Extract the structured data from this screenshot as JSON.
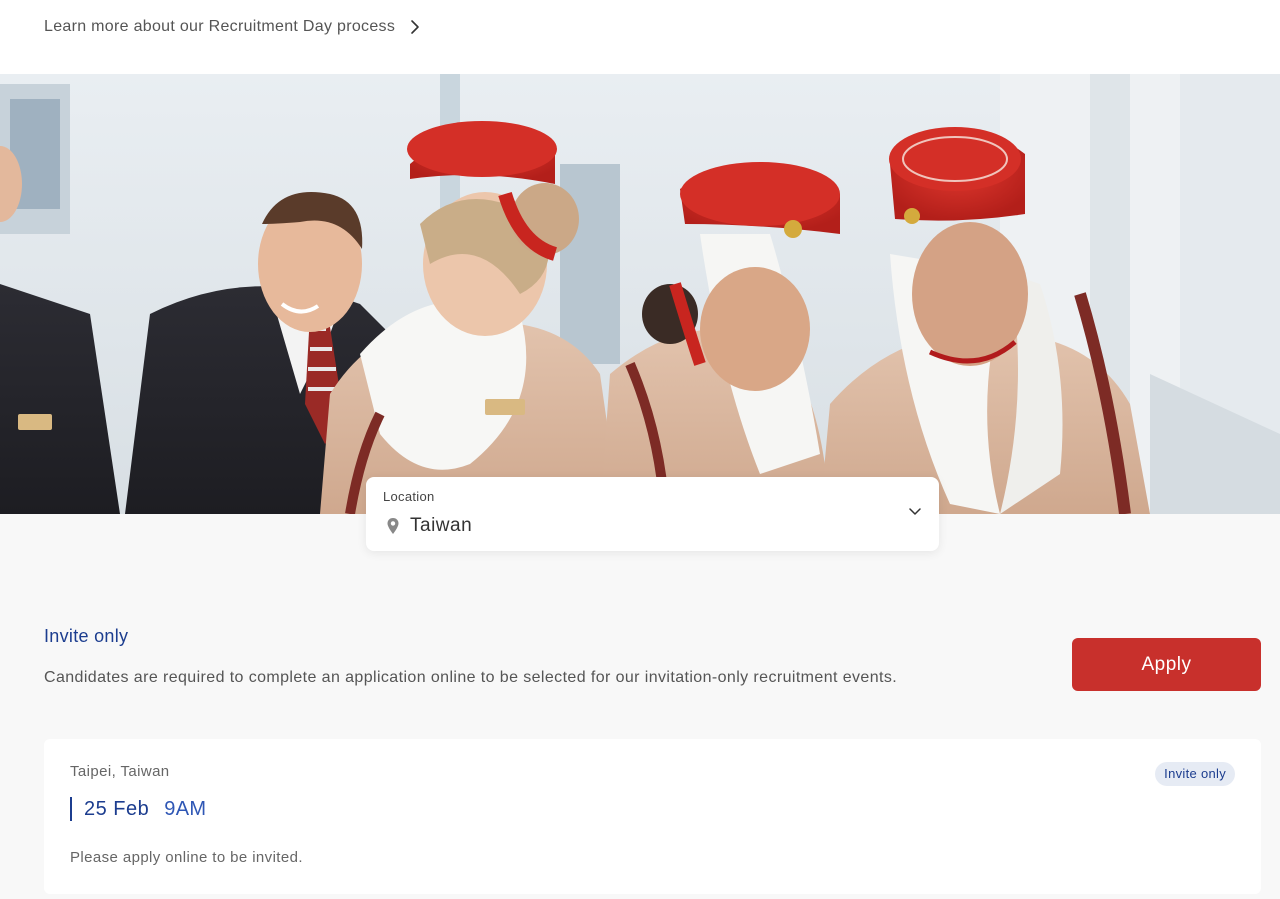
{
  "top": {
    "learn_more_label": "Learn more about our Recruitment Day process"
  },
  "location": {
    "label": "Location",
    "selected": "Taiwan"
  },
  "invite_section": {
    "title": "Invite only",
    "description": "Candidates are required to complete an application online to be selected for our invitation-only recruitment events.",
    "apply_label": "Apply"
  },
  "events": [
    {
      "city": "Taipei, Taiwan",
      "date": "25 Feb",
      "time": "9AM",
      "badge": "Invite only",
      "note": "Please apply online to be invited."
    }
  ],
  "colors": {
    "accent_red": "#c8302c",
    "brand_blue": "#1c3d8f",
    "badge_bg": "#e6ebf4"
  }
}
